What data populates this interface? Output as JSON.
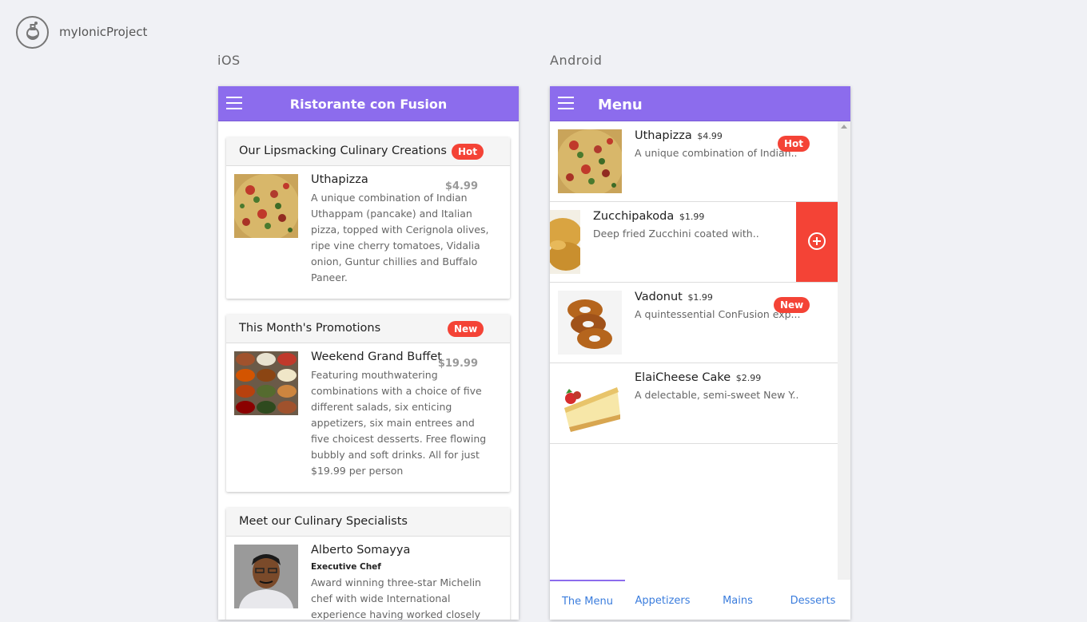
{
  "app": {
    "project_name": "myIonicProject"
  },
  "platforms": {
    "ios_label": "iOS",
    "android_label": "Android"
  },
  "ios": {
    "title": "Ristorante con Fusion",
    "cards": [
      {
        "title": "Our Lipsmacking Culinary Creations",
        "badge": "Hot",
        "item_name": "Uthapizza",
        "price": "$4.99",
        "description": "A unique combination of Indian Uthappam (pancake) and Italian pizza, topped with Cerignola olives, ripe vine cherry tomatoes, Vidalia onion, Guntur chillies and Buffalo Paneer."
      },
      {
        "title": "This Month's Promotions",
        "badge": "New",
        "item_name": "Weekend Grand Buffet",
        "price": "$19.99",
        "description": "Featuring mouthwatering combinations with a choice of five different salads, six enticing appetizers, six main entrees and five choicest desserts. Free flowing bubbly and soft drinks. All for just $19.99 per person"
      },
      {
        "title": "Meet our Culinary Specialists",
        "item_name": "Alberto Somayya",
        "designation": "Executive Chef",
        "description": "Award winning three-star Michelin chef with wide International experience having worked closely"
      }
    ]
  },
  "android": {
    "title": "Menu",
    "items": [
      {
        "name": "Uthapizza",
        "price": "$4.99",
        "description": "A unique combination of Indian..",
        "badge": "Hot"
      },
      {
        "name": "Zucchipakoda",
        "price": "$1.99",
        "description": "Deep fried Zucchini coated with.."
      },
      {
        "name": "Vadonut",
        "price": "$1.99",
        "description": "A quintessential ConFusion exp...",
        "badge": "New"
      },
      {
        "name": "ElaiCheese Cake",
        "price": "$2.99",
        "description": "A delectable, semi-sweet New Y.."
      }
    ],
    "tabs": [
      "The Menu",
      "Appetizers",
      "Mains",
      "Desserts"
    ],
    "active_tab": "The Menu"
  },
  "colors": {
    "toolbar": "#8c6ced",
    "badge": "#f44336",
    "tab_text": "#3b7ddd"
  },
  "icons": [
    "ionic-logo-icon",
    "hamburger-menu-icon",
    "add-circle-icon",
    "scroll-up-arrow-icon"
  ]
}
